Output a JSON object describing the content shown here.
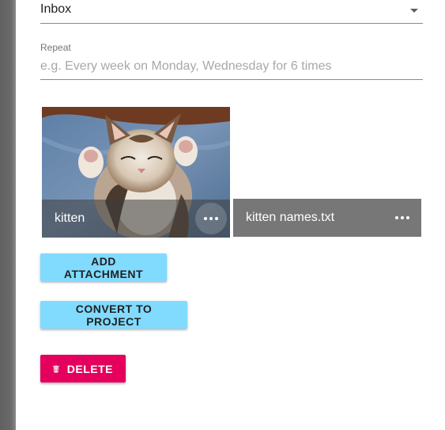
{
  "project": {
    "value": "Inbox"
  },
  "repeat": {
    "label": "Repeat",
    "placeholder": "e.g. Every week on Monday, Wednesday for 6 times"
  },
  "attachments": [
    {
      "title": "kitten",
      "type": "image"
    },
    {
      "title": "kitten names.txt",
      "type": "file"
    }
  ],
  "buttons": {
    "add_attachment": "ADD ATTACHMENT",
    "convert": "CONVERT TO PROJECT",
    "delete": "DELETE"
  },
  "colors": {
    "accent_light": "#80dbff",
    "danger": "#e5005d"
  },
  "icons": {
    "more": "more-horiz-icon",
    "delete": "trash-icon",
    "dropdown": "arrow-drop-down-icon"
  }
}
